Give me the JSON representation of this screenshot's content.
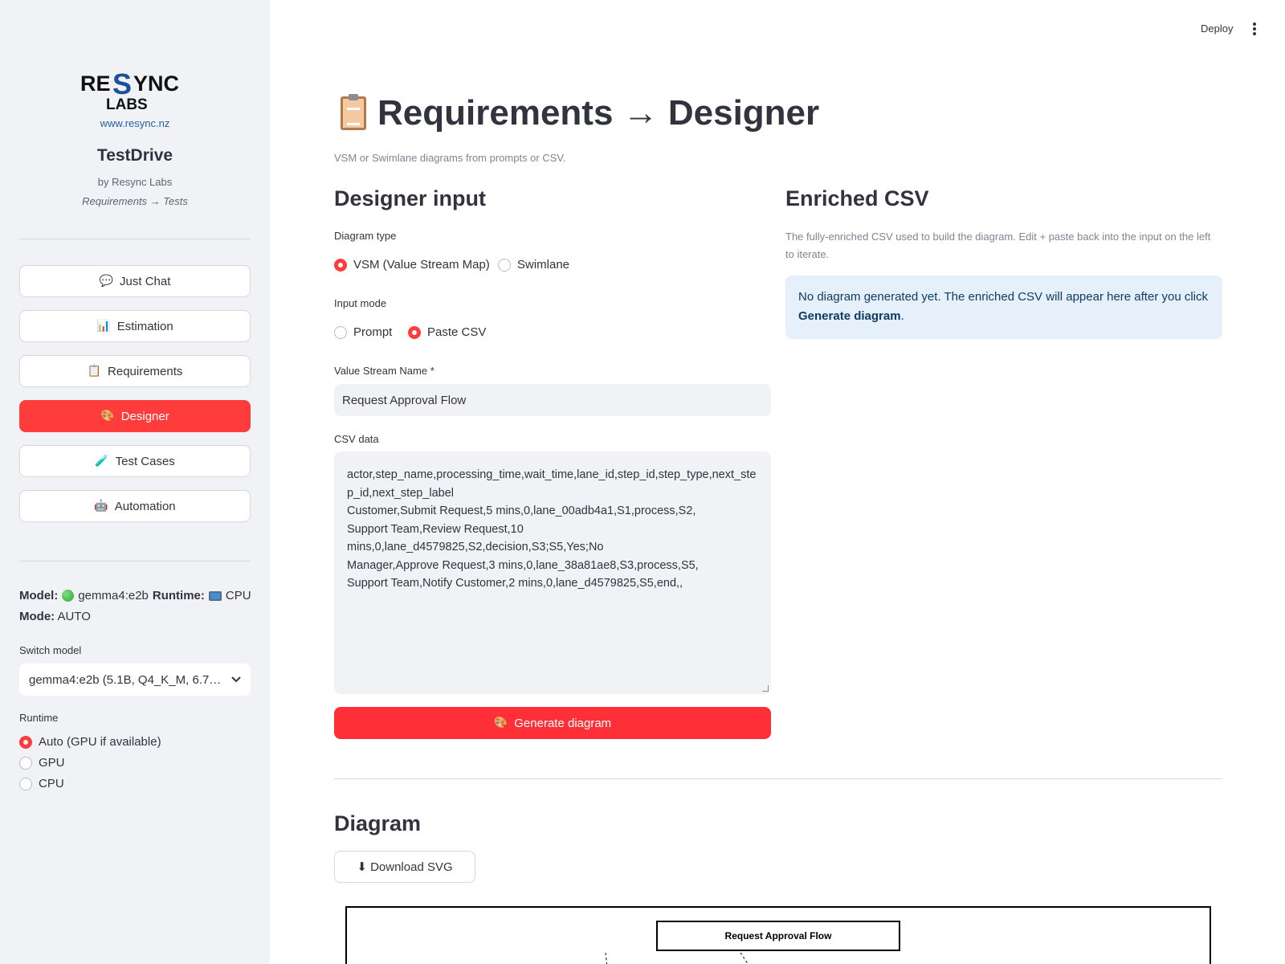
{
  "sidebar": {
    "logo_text": "RESYNC LABS",
    "site_link": "www.resync.nz",
    "app_title": "TestDrive",
    "app_by": "by Resync Labs",
    "app_tag": "Requirements → Tests",
    "nav": [
      {
        "icon": "speech-bubble-icon",
        "glyph": "💬",
        "label": "Just Chat",
        "active": false
      },
      {
        "icon": "bar-chart-icon",
        "glyph": "📊",
        "label": "Estimation",
        "active": false
      },
      {
        "icon": "clipboard-icon",
        "glyph": "📋",
        "label": "Requirements",
        "active": false
      },
      {
        "icon": "palette-icon",
        "glyph": "🎨",
        "label": "Designer",
        "active": true
      },
      {
        "icon": "test-tube-icon",
        "glyph": "🧪",
        "label": "Test Cases",
        "active": false
      },
      {
        "icon": "robot-icon",
        "glyph": "🤖",
        "label": "Automation",
        "active": false
      }
    ],
    "model_label": "Model:",
    "model_value": "gemma4:e2b",
    "runtime_label": "Runtime:",
    "runtime_value": "CPU",
    "mode_label": "Mode:",
    "mode_value": "AUTO",
    "switch_model_label": "Switch model",
    "switch_model_value": "gemma4:e2b (5.1B, Q4_K_M, 6.7…",
    "runtime_section_label": "Runtime",
    "runtime_options": [
      {
        "label": "Auto (GPU if available)",
        "checked": true
      },
      {
        "label": "GPU",
        "checked": false
      },
      {
        "label": "CPU",
        "checked": false
      }
    ]
  },
  "header": {
    "deploy_label": "Deploy"
  },
  "main": {
    "title_text": "Requirements → Designer",
    "caption": "VSM or Swimlane diagrams from prompts or CSV.",
    "designer_input": {
      "heading": "Designer input",
      "diagram_type_label": "Diagram type",
      "diagram_type_options": [
        {
          "label": "VSM (Value Stream Map)",
          "checked": true
        },
        {
          "label": "Swimlane",
          "checked": false
        }
      ],
      "input_mode_label": "Input mode",
      "input_mode_options": [
        {
          "label": "Prompt",
          "checked": false
        },
        {
          "label": "Paste CSV",
          "checked": true
        }
      ],
      "value_stream_label": "Value Stream Name *",
      "value_stream_value": "Request Approval Flow",
      "csv_label": "CSV data",
      "csv_value": "actor,step_name,processing_time,wait_time,lane_id,step_id,step_type,next_step_id,next_step_label\nCustomer,Submit Request,5 mins,0,lane_00adb4a1,S1,process,S2,\nSupport Team,Review Request,10\nmins,0,lane_d4579825,S2,decision,S3;S5,Yes;No\nManager,Approve Request,3 mins,0,lane_38a81ae8,S3,process,S5,\nSupport Team,Notify Customer,2 mins,0,lane_d4579825,S5,end,,",
      "generate_label": "Generate diagram"
    },
    "enriched_csv": {
      "heading": "Enriched CSV",
      "description": "The fully-enriched CSV used to build the diagram. Edit + paste back into the input on the left to iterate.",
      "info_prefix": "No diagram generated yet. The enriched CSV will appear here after you click ",
      "info_bold": "Generate diagram",
      "info_suffix": "."
    },
    "diagram": {
      "heading": "Diagram",
      "download_label": "⬇ Download SVG",
      "svg_title": "Request Approval Flow"
    }
  },
  "colors": {
    "accent": "#ff3c3c",
    "sidebar_bg": "#f0f2f6",
    "info_bg": "#e6f0fb"
  }
}
